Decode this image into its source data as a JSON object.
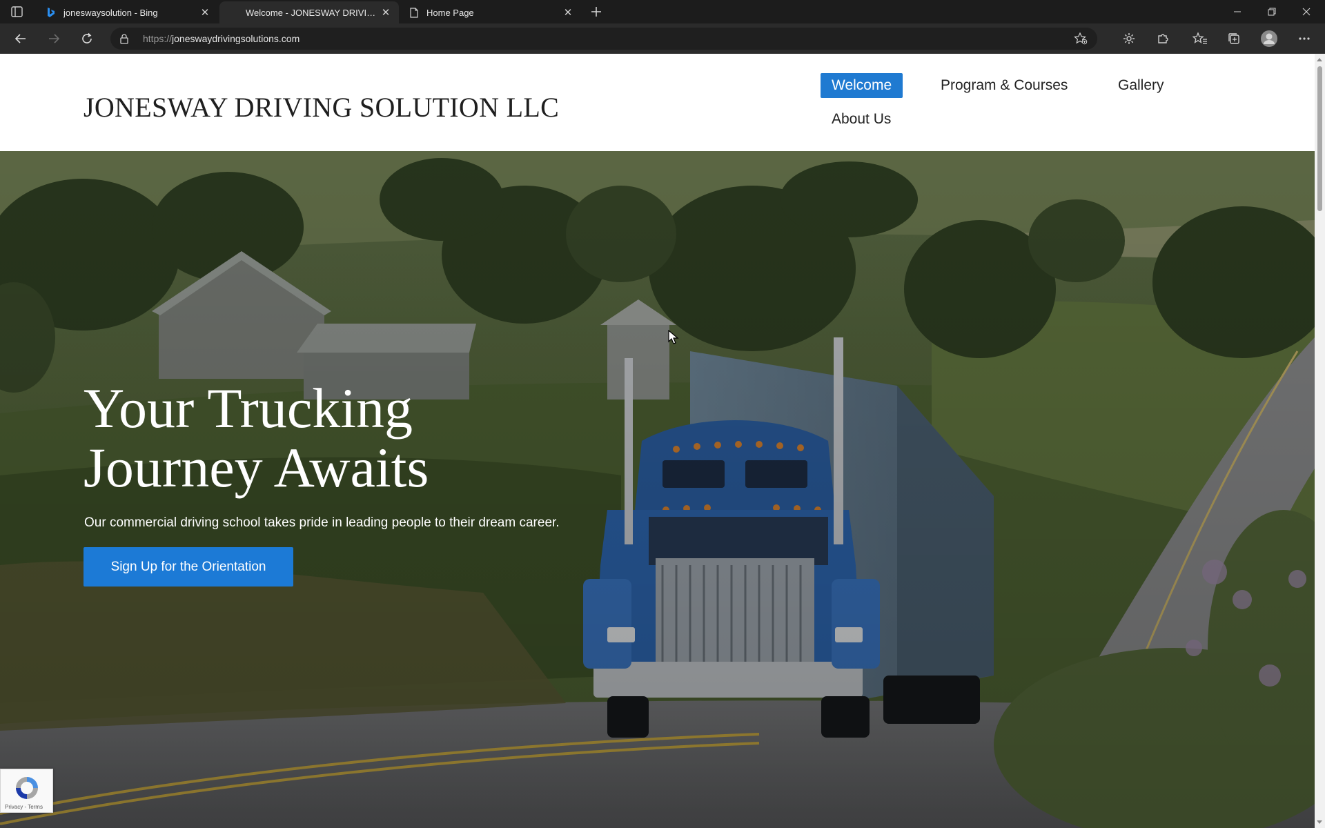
{
  "browser": {
    "tabs": [
      {
        "title": "joneswaysolution - Bing",
        "favicon": "bing-icon",
        "active": false
      },
      {
        "title": "Welcome - JONESWAY DRIVING SOLUTION LLC",
        "favicon": "none",
        "active": true
      },
      {
        "title": "Home Page",
        "favicon": "page-icon",
        "active": false
      }
    ],
    "address": {
      "scheme": "https://",
      "host": "joneswaydrivingsolutions.com"
    }
  },
  "site": {
    "logo": "JONESWAY DRIVING SOLUTION LLC",
    "nav": [
      {
        "label": "Welcome",
        "active": true
      },
      {
        "label": "Program & Courses",
        "active": false
      },
      {
        "label": "Gallery",
        "active": false
      },
      {
        "label": "About Us",
        "active": false
      }
    ],
    "accent_color": "#1f7ad1"
  },
  "hero": {
    "title_line1": "Your Trucking",
    "title_line2": "Journey Awaits",
    "subtitle": "Our commercial driving school takes pride in leading people to their dream career.",
    "cta_label": "Sign Up for the Orientation"
  },
  "recaptcha": {
    "terms": "Privacy - Terms"
  }
}
